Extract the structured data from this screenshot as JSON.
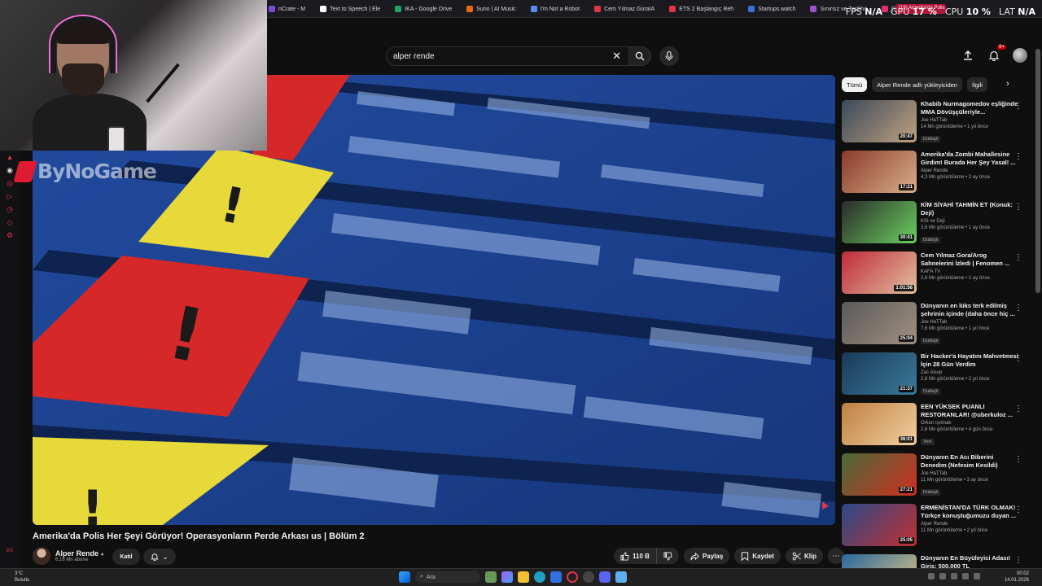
{
  "bookmarks": [
    {
      "label": "nCrate - M",
      "color": "#7a4bd8"
    },
    {
      "label": "Text to Speech | Ele",
      "color": "#ffffff"
    },
    {
      "label": "IKA - Google Drive",
      "color": "#1fa463"
    },
    {
      "label": "Suno | AI Music",
      "color": "#e8691c"
    },
    {
      "label": "I'm Not a Robot",
      "color": "#5b8def"
    },
    {
      "label": "Cem Yılmaz Gora/A",
      "color": "#e2334a"
    },
    {
      "label": "ETS 2 Başlangıç Reh",
      "color": "#e2334a"
    },
    {
      "label": "Startups.watch",
      "color": "#3b6fd8"
    },
    {
      "label": "Sınırsız ve Tashhıt",
      "color": "#a050d0"
    },
    {
      "label": "(9) Instagram",
      "color": "#e1306c"
    }
  ],
  "active_tab": "(18) Amerika'da Polis",
  "hud": {
    "fps_label": "FPS",
    "fps_value": "N/A",
    "gpu_label": "GPU",
    "gpu_value": "17 %",
    "cpu_label": "CPU",
    "cpu_value": "10 %",
    "lat_label": "LAT",
    "lat_value": "N/A"
  },
  "logo_text": "ByNoGame",
  "search": {
    "value": "alper rende"
  },
  "notifications_badge": "9+",
  "video": {
    "title": "Amerika'da Polis Her Şeyi Görüyor! Operasyonların Perde Arkası us | Bölüm 2",
    "channel": "Alper Rende",
    "subscribers": "6,16 Mn abone",
    "join_label": "Katıl",
    "likes": "110 B",
    "share_label": "Paylaş",
    "save_label": "Kaydet",
    "clip_label": "Klip"
  },
  "chips": [
    "Tümü",
    "Alper Rende adlı yükleyiciden",
    "İlgili"
  ],
  "recommendations": [
    {
      "title": "Khabib Nurmagomedov eşliğinde MMA Dövüşçüleriyle...",
      "channel": "Joe HaTTab",
      "stats": "14 Mn görüntüleme • 1 yıl önce",
      "badge": "Dublajlı",
      "duration": "20:47",
      "c1": "#3a4a5a",
      "c2": "#c0a080"
    },
    {
      "title": "Amerika'da Zombi Mahallesine Girdim! Burada Her Şey Yasal! ...",
      "channel": "Alper Rende",
      "stats": "4,3 Mn görüntüleme • 2 ay önce",
      "badge": "",
      "duration": "17:21",
      "c1": "#8a3a2a",
      "c2": "#d9b089"
    },
    {
      "title": "KİM SİYAHİ TAHMİN ET (Konuk: Deji)",
      "channel": "KSI ve Deji",
      "stats": "3,6 Mn görüntüleme • 1 ay önce",
      "badge": "Dublajlı",
      "duration": "30:41",
      "c1": "#2a2a2a",
      "c2": "#6ad060"
    },
    {
      "title": "Cem Yılmaz Gora/Arog Sahnelerini İzledi | Fenomen ...",
      "channel": "KAFA TV",
      "stats": "2,6 Mn görüntüleme • 1 ay önce",
      "badge": "",
      "duration": "1:01:56",
      "c1": "#c02a3a",
      "c2": "#e0c0a0"
    },
    {
      "title": "Dünyanın en lüks terk edilmiş şehrinin içinde (daha önce hiç ...",
      "channel": "Joe HaTTab",
      "stats": "7,6 Mn görüntüleme • 1 yıl önce",
      "badge": "Dublajlı",
      "duration": "25:04",
      "c1": "#5a5a5a",
      "c2": "#a09080"
    },
    {
      "title": "Bir Hacker'a Hayatını Mahvetmesi İçin 28 Gün Verdim",
      "channel": "Zac Alsop",
      "stats": "2,6 Mn görüntüleme • 2 yıl önce",
      "badge": "Dublajlı",
      "duration": "21:37",
      "c1": "#1a3a5a",
      "c2": "#3a7a9a"
    },
    {
      "title": "EEN YÜKSEK PUANLI RESTORANLAR! @uberkuloz ...",
      "channel": "Orkun Işıtmak",
      "stats": "2,6 Mn görüntüleme • 4 gün önce",
      "badge": "Yeni",
      "duration": "36:01",
      "c1": "#c08040",
      "c2": "#f0d0a0"
    },
    {
      "title": "Dünyanın En Acı Biberini Denedim (Nefesim Kesildi)",
      "channel": "Joe HaTTab",
      "stats": "11 Mn görüntüleme • 3 ay önce",
      "badge": "Dublajlı",
      "duration": "27:21",
      "c1": "#4a6a3a",
      "c2": "#d03020"
    },
    {
      "title": "ERMENİSTAN'DA TÜRK OLMAK! Türkçe konuştuğumuzu duyan ...",
      "channel": "Alper Rende",
      "stats": "11 Mn görüntüleme • 2 yıl önce",
      "badge": "",
      "duration": "25:05",
      "c1": "#2a4a8a",
      "c2": "#c03030"
    },
    {
      "title": "Dünyanın En Büyüleyici Adası! Giriş: 500.000 TL",
      "channel": "Alper Rende",
      "stats": "",
      "badge": "",
      "duration": "",
      "c1": "#2a6aa0",
      "c2": "#e0c080"
    }
  ],
  "taskbar": {
    "weather_temp": "3°C",
    "weather_desc": "Bulutlu",
    "search_placeholder": "Ara",
    "time": "00:02",
    "date": "14.01.2026"
  },
  "colors": {
    "bg": "#0f0f0f",
    "accent_red": "#cc0000",
    "opera_red": "#e2334a"
  }
}
